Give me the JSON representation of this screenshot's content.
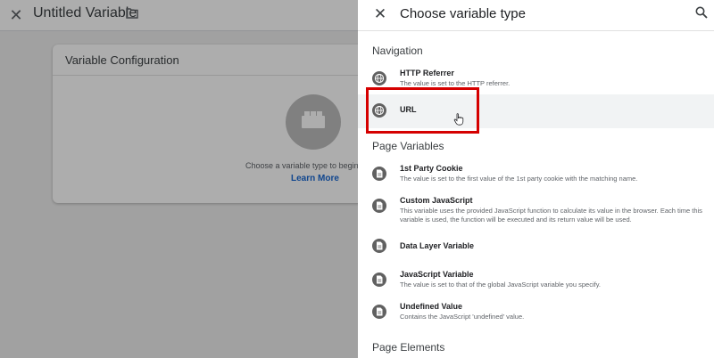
{
  "background": {
    "title": "Untitled Variable",
    "card_title": "Variable Configuration",
    "choose_text": "Choose a variable type to begin s",
    "learn_more": "Learn More"
  },
  "panel": {
    "title": "Choose variable type",
    "sections": [
      {
        "title": "Navigation",
        "items": [
          {
            "name": "HTTP Referrer",
            "desc": "The value is set to the HTTP referrer.",
            "icon": "globe-icon"
          },
          {
            "name": "URL",
            "desc": "",
            "icon": "globe-icon",
            "selected": true
          }
        ]
      },
      {
        "title": "Page Variables",
        "items": [
          {
            "name": "1st Party Cookie",
            "desc": "The value is set to the first value of the 1st party cookie with the matching name.",
            "icon": "document-icon"
          },
          {
            "name": "Custom JavaScript",
            "desc": "This variable uses the provided JavaScript function to calculate its value in the browser. Each time this variable is used, the function will be executed and its return value will be used.",
            "icon": "document-icon"
          },
          {
            "name": "Data Layer Variable",
            "desc": "",
            "icon": "document-icon"
          },
          {
            "name": "JavaScript Variable",
            "desc": "The value is set to that of the global JavaScript variable you specify.",
            "icon": "document-icon"
          },
          {
            "name": "Undefined Value",
            "desc": "Contains the JavaScript 'undefined' value.",
            "icon": "document-icon"
          }
        ]
      },
      {
        "title": "Page Elements",
        "items": []
      }
    ]
  },
  "colors": {
    "highlight": "#d50000",
    "link": "#1967d2",
    "icon": "#616161"
  }
}
